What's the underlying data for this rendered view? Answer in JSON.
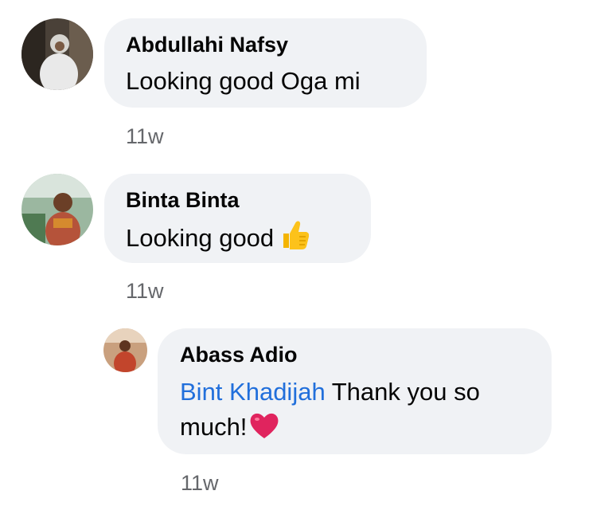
{
  "comments": [
    {
      "author": "Abdullahi Nafsy",
      "text": "Looking good Oga mi",
      "time": "11w",
      "avatar_icon": "avatar-photo"
    },
    {
      "author": "Binta Binta",
      "text": "Looking good",
      "emoji_icon": "thumbs-up-icon",
      "time": "11w",
      "avatar_icon": "avatar-photo"
    }
  ],
  "reply": {
    "author": "Abass Adio",
    "mention": "Bint Khadijah",
    "text_line1": "Thank you so",
    "text_line2": "much!",
    "emoji_icon": "red-heart-icon",
    "time": "11w",
    "avatar_icon": "avatar-photo"
  },
  "colors": {
    "bubble": "#f0f2f5",
    "mention": "#216fdb",
    "meta_text": "#65676b"
  }
}
